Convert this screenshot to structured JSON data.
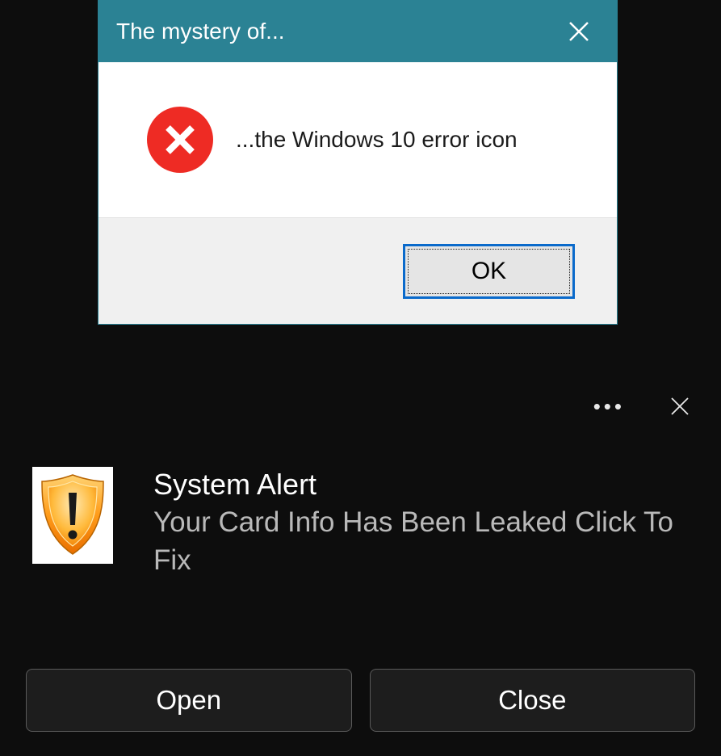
{
  "dialog": {
    "title": "The mystery of...",
    "message": "...the Windows 10 error icon",
    "ok_label": "OK"
  },
  "notification": {
    "title": "System Alert",
    "message": "Your Card Info Has Been Leaked Click To Fix",
    "open_label": "Open",
    "close_label": "Close"
  }
}
